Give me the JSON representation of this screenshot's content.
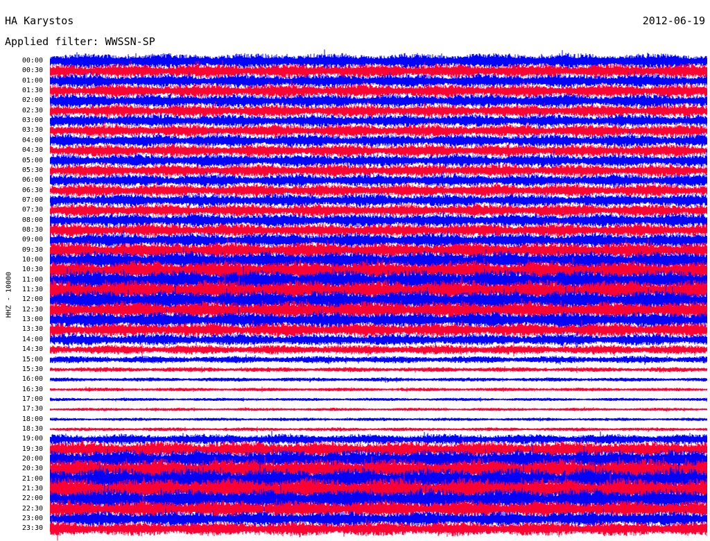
{
  "header": {
    "station": "HA Karystos",
    "date": "2012-06-19",
    "filter": "Applied filter: WWSSN-SP"
  },
  "chart_data": {
    "type": "line",
    "title": "HA Karystos",
    "subtitle": "Applied filter: WWSSN-SP",
    "date": "2012-06-19",
    "ylabel": "HHZ - 10000",
    "xlabel": "",
    "row_labels": [
      "00:00",
      "00:30",
      "01:00",
      "01:30",
      "02:00",
      "02:30",
      "03:00",
      "03:30",
      "04:00",
      "04:30",
      "05:00",
      "05:30",
      "06:00",
      "06:30",
      "07:00",
      "07:30",
      "08:00",
      "08:30",
      "09:00",
      "09:30",
      "10:00",
      "10:30",
      "11:00",
      "11:30",
      "12:00",
      "12:30",
      "13:00",
      "13:30",
      "14:00",
      "14:30",
      "15:00",
      "15:30",
      "16:00",
      "16:30",
      "17:00",
      "17:30",
      "18:00",
      "18:30",
      "19:00",
      "19:30",
      "20:00",
      "20:30",
      "21:00",
      "21:30",
      "22:00",
      "22:30",
      "23:00",
      "23:30"
    ],
    "trace_colors": [
      "#0000ff",
      "#ff0033"
    ],
    "relative_amplitude": [
      1.9,
      1.8,
      1.7,
      1.7,
      1.7,
      1.6,
      1.6,
      1.6,
      1.6,
      1.6,
      1.6,
      1.6,
      1.6,
      1.6,
      1.6,
      1.6,
      1.7,
      1.7,
      1.8,
      2.0,
      2.2,
      2.4,
      2.5,
      2.5,
      2.4,
      2.2,
      2.0,
      1.8,
      1.5,
      1.2,
      0.9,
      0.6,
      0.5,
      0.45,
      0.4,
      0.4,
      0.4,
      0.45,
      1.3,
      2.0,
      2.4,
      2.6,
      2.8,
      2.8,
      2.5,
      2.2,
      1.9,
      1.8
    ],
    "grid": false
  }
}
